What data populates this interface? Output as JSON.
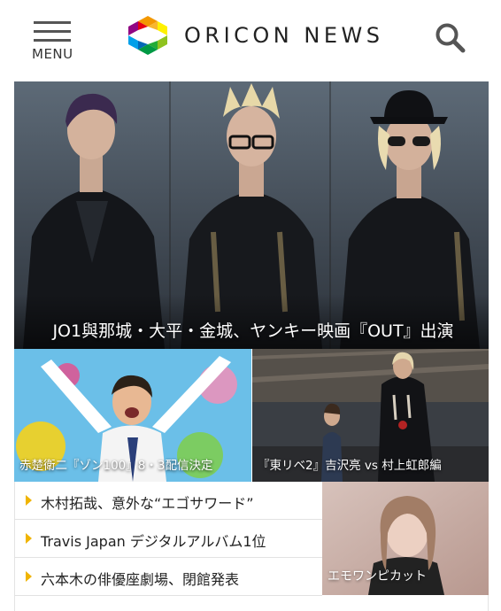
{
  "header": {
    "menu_label": "MENU",
    "logo_text": "ORICON NEWS",
    "logo_colors": [
      "#e60012",
      "#f39800",
      "#fff100",
      "#009944",
      "#00a0e9",
      "#920783"
    ]
  },
  "hero": {
    "title": "JO1與那城・大平・金城、ヤンキー映画『OUT』出演"
  },
  "tiles": [
    {
      "title": "赤楚衛二『ゾン100』8・3配信決定"
    },
    {
      "title": "『東リベ2』吉沢亮 vs 村上虹郎編"
    }
  ],
  "news_list": [
    {
      "text": "木村拓哉、意外な“エゴサワード”"
    },
    {
      "text": "Travis Japan デジタルアルバム1位"
    },
    {
      "text": "六本木の俳優座劇場、閉館発表"
    }
  ],
  "side_tile": {
    "title": "エモワンピカット"
  },
  "colors": {
    "accent_arrow": "#f0b400",
    "text": "#222222"
  }
}
